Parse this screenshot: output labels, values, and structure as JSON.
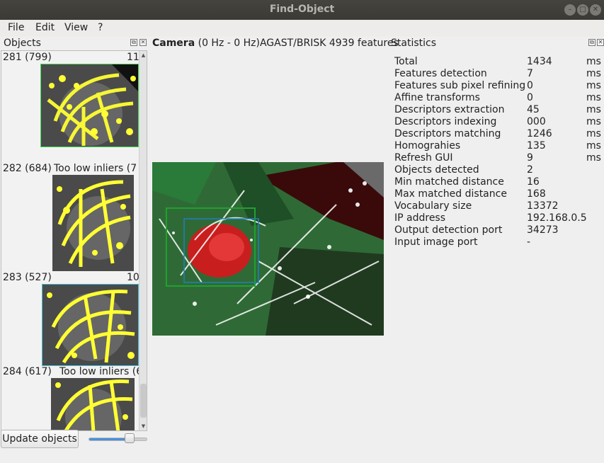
{
  "window": {
    "title": "Find-Object"
  },
  "menu": [
    "File",
    "Edit",
    "View",
    "?"
  ],
  "objects_dock": {
    "title": "Objects",
    "items": [
      {
        "label": "281 (799)",
        "status": "11"
      },
      {
        "label": "282 (684)",
        "status": "Too low inliers (7"
      },
      {
        "label": "283 (527)",
        "status": "10"
      },
      {
        "label": "284 (617)",
        "status": "Too low inliers (6"
      }
    ]
  },
  "update_button": "Update objects",
  "slider": {
    "value": 0.7
  },
  "camera": {
    "label": "Camera",
    "info": "(0 Hz - 0 Hz)AGAST/BRISK 4939 features"
  },
  "statistics": {
    "title": "Statistics",
    "rows": [
      {
        "name": "Total",
        "value": "1434",
        "unit": "ms"
      },
      {
        "name": "Features detection",
        "value": "7",
        "unit": "ms"
      },
      {
        "name": "Features sub pixel refining",
        "value": "0",
        "unit": "ms"
      },
      {
        "name": "Affine transforms",
        "value": "0",
        "unit": "ms"
      },
      {
        "name": "Descriptors extraction",
        "value": "45",
        "unit": "ms"
      },
      {
        "name": "Descriptors indexing",
        "value": "000",
        "unit": "ms"
      },
      {
        "name": "Descriptors matching",
        "value": "1246",
        "unit": "ms"
      },
      {
        "name": "Homograhies",
        "value": "135",
        "unit": "ms"
      },
      {
        "name": "Refresh GUI",
        "value": "9",
        "unit": "ms"
      },
      {
        "name": "Objects detected",
        "value": "2",
        "unit": ""
      },
      {
        "name": "Min matched distance",
        "value": "16",
        "unit": ""
      },
      {
        "name": "Max matched distance",
        "value": "168",
        "unit": ""
      },
      {
        "name": "Vocabulary size",
        "value": "13372",
        "unit": ""
      },
      {
        "name": "IP address",
        "value": "192.168.0.5",
        "unit": ""
      },
      {
        "name": "Output detection port",
        "value": "34273",
        "unit": ""
      },
      {
        "name": "Input image port",
        "value": "-",
        "unit": ""
      }
    ]
  }
}
